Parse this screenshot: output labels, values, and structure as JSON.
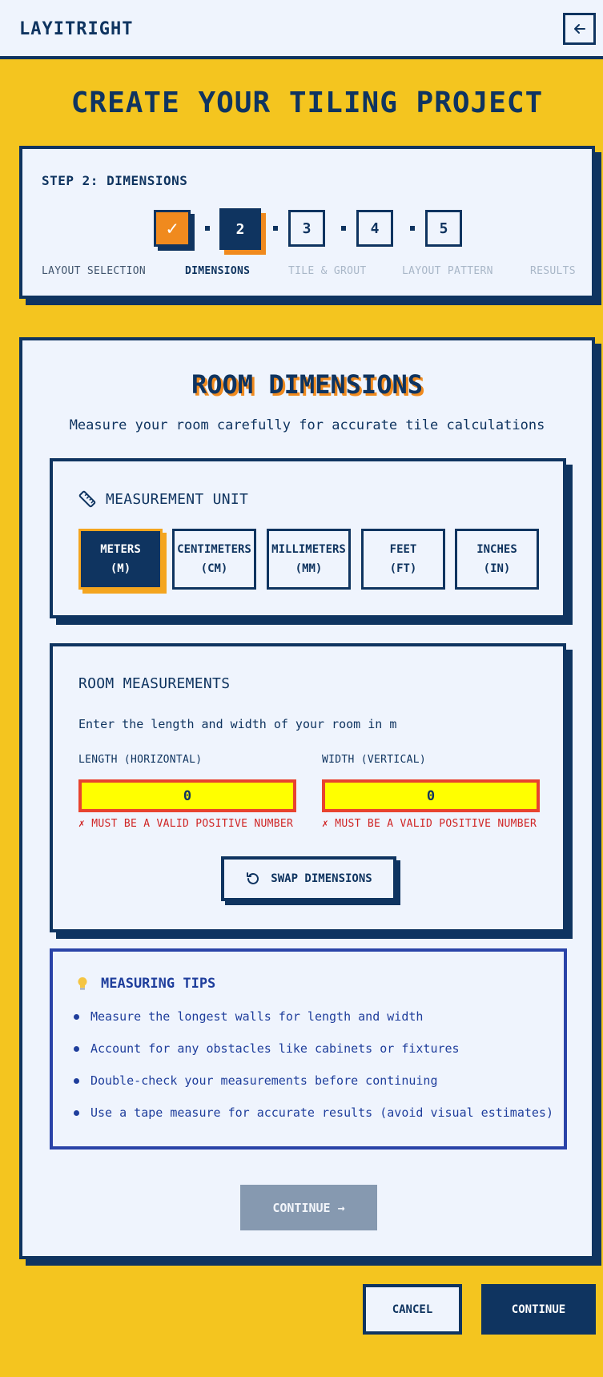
{
  "header": {
    "brand": "LAYITRIGHT",
    "back_icon": "arrow-left-icon"
  },
  "page": {
    "title": "CREATE YOUR TILING PROJECT"
  },
  "stepper": {
    "label": "STEP 2: DIMENSIONS",
    "steps": [
      {
        "number": "✓",
        "name": "LAYOUT SELECTION",
        "state": "done"
      },
      {
        "number": "2",
        "name": "DIMENSIONS",
        "state": "active"
      },
      {
        "number": "3",
        "name": "TILE & GROUT",
        "state": "todo"
      },
      {
        "number": "4",
        "name": "LAYOUT PATTERN",
        "state": "todo"
      },
      {
        "number": "5",
        "name": "RESULTS",
        "state": "todo"
      }
    ]
  },
  "room": {
    "title": "ROOM DIMENSIONS",
    "subtitle": "Measure your room carefully for accurate tile calculations"
  },
  "unit_section": {
    "heading": "MEASUREMENT UNIT",
    "icon": "ruler-icon",
    "units": [
      {
        "name": "METERS",
        "abbr": "(M)",
        "selected": true
      },
      {
        "name": "CENTIMETERS",
        "abbr": "(CM)",
        "selected": false
      },
      {
        "name": "MILLIMETERS",
        "abbr": "(MM)",
        "selected": false
      },
      {
        "name": "FEET",
        "abbr": "(FT)",
        "selected": false
      },
      {
        "name": "INCHES",
        "abbr": "(IN)",
        "selected": false
      }
    ]
  },
  "measurements": {
    "heading": "ROOM MEASUREMENTS",
    "description": "Enter the length and width of your room in m",
    "length": {
      "label": "LENGTH (HORIZONTAL)",
      "value": "0",
      "error": "✗ MUST BE A VALID POSITIVE NUMBER"
    },
    "width": {
      "label": "WIDTH (VERTICAL)",
      "value": "0",
      "error": "✗ MUST BE A VALID POSITIVE NUMBER"
    },
    "swap_label": "SWAP DIMENSIONS",
    "swap_icon": "rotate-icon"
  },
  "tips": {
    "heading": "MEASURING TIPS",
    "icon": "lightbulb-icon",
    "items": [
      "Measure the longest walls for length and width",
      "Account for any obstacles like cabinets or fixtures",
      "Double-check your measurements before continuing",
      "Use a tape measure for accurate results (avoid visual estimates)"
    ]
  },
  "actions": {
    "inner_continue": "CONTINUE →",
    "cancel": "CANCEL",
    "continue": "CONTINUE"
  },
  "colors": {
    "background": "#F4C51F",
    "navy": "#0F3460",
    "orange": "#F08A1E",
    "panel": "#EFF4FD",
    "error": "#D02525",
    "tips_blue": "#1F3E9C",
    "input_yellow": "#FFFF00"
  }
}
